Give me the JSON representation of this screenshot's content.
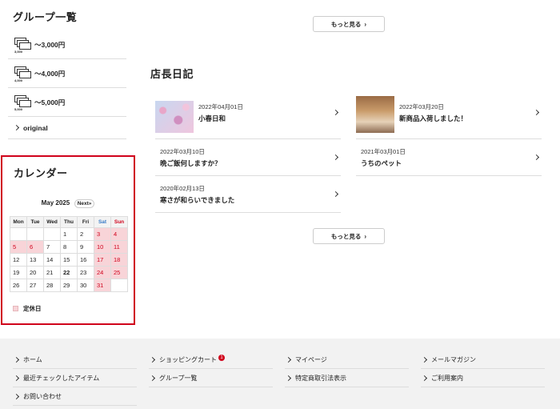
{
  "sidebar": {
    "groups_title": "グループ一覧",
    "groups": [
      {
        "amount": "3,000",
        "label": "～3,000円"
      },
      {
        "amount": "4,000",
        "label": "～4,000円"
      },
      {
        "amount": "5,000",
        "label": "～5,000円"
      }
    ],
    "original_label": "original"
  },
  "calendar": {
    "title": "カレンダー",
    "month_label": "May 2025",
    "next_label": "Next»",
    "weekdays": [
      "Mon",
      "Tue",
      "Wed",
      "Thu",
      "Fri",
      "Sat",
      "Sun"
    ],
    "weeks": [
      [
        "",
        "",
        "",
        "1",
        "2",
        "3",
        "4"
      ],
      [
        "5",
        "6",
        "7",
        "8",
        "9",
        "10",
        "11"
      ],
      [
        "12",
        "13",
        "14",
        "15",
        "16",
        "17",
        "18"
      ],
      [
        "19",
        "20",
        "21",
        "22",
        "23",
        "24",
        "25"
      ],
      [
        "26",
        "27",
        "28",
        "29",
        "30",
        "31",
        ""
      ]
    ],
    "holidays": [
      "3",
      "4",
      "5",
      "6",
      "10",
      "11",
      "17",
      "18",
      "24",
      "25",
      "31"
    ],
    "today": "22",
    "legend_label": "定休日",
    "holiday_color": "#f8d4d8"
  },
  "main": {
    "more_button_label": "もっと見る",
    "diary_title": "店長日記",
    "diary": [
      {
        "date": "2022年04月01日",
        "title": "小春日和",
        "thumb": "sakura"
      },
      {
        "date": "2022年03月20日",
        "title": "新商品入荷しました！",
        "thumb": "room"
      },
      {
        "date": "2022年03月10日",
        "title": "晩ご飯何しますか？",
        "thumb": ""
      },
      {
        "date": "2021年03月01日",
        "title": "うちのペット",
        "thumb": ""
      },
      {
        "date": "2020年02月13日",
        "title": "寒さが和らいできました",
        "thumb": ""
      }
    ]
  },
  "footer": {
    "links": [
      "ホーム",
      "ショッピングカート",
      "マイページ",
      "メールマガジン",
      "最近チェックしたアイテム",
      "グループ一覧",
      "特定商取引法表示",
      "ご利用案内",
      "お問い合わせ"
    ],
    "cart_badge": "1"
  },
  "colors": {
    "accent": "#d0021b",
    "footer_bg": "#f2f2f2"
  }
}
